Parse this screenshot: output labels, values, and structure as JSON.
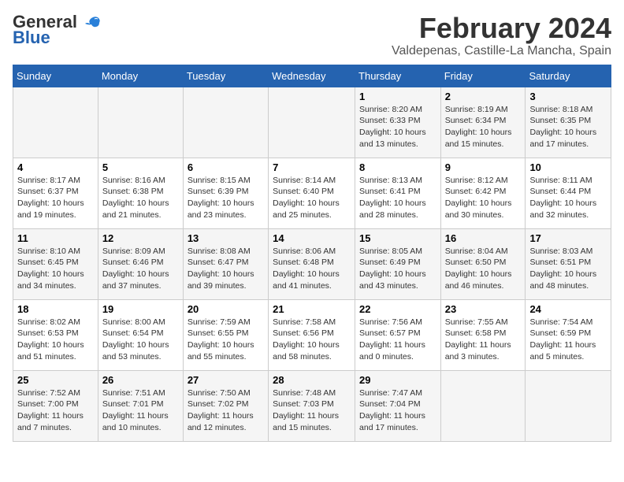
{
  "logo": {
    "general": "General",
    "blue": "Blue"
  },
  "header": {
    "title": "February 2024",
    "subtitle": "Valdepenas, Castille-La Mancha, Spain"
  },
  "weekdays": [
    "Sunday",
    "Monday",
    "Tuesday",
    "Wednesday",
    "Thursday",
    "Friday",
    "Saturday"
  ],
  "weeks": [
    [
      {
        "day": "",
        "detail": ""
      },
      {
        "day": "",
        "detail": ""
      },
      {
        "day": "",
        "detail": ""
      },
      {
        "day": "",
        "detail": ""
      },
      {
        "day": "1",
        "detail": "Sunrise: 8:20 AM\nSunset: 6:33 PM\nDaylight: 10 hours\nand 13 minutes."
      },
      {
        "day": "2",
        "detail": "Sunrise: 8:19 AM\nSunset: 6:34 PM\nDaylight: 10 hours\nand 15 minutes."
      },
      {
        "day": "3",
        "detail": "Sunrise: 8:18 AM\nSunset: 6:35 PM\nDaylight: 10 hours\nand 17 minutes."
      }
    ],
    [
      {
        "day": "4",
        "detail": "Sunrise: 8:17 AM\nSunset: 6:37 PM\nDaylight: 10 hours\nand 19 minutes."
      },
      {
        "day": "5",
        "detail": "Sunrise: 8:16 AM\nSunset: 6:38 PM\nDaylight: 10 hours\nand 21 minutes."
      },
      {
        "day": "6",
        "detail": "Sunrise: 8:15 AM\nSunset: 6:39 PM\nDaylight: 10 hours\nand 23 minutes."
      },
      {
        "day": "7",
        "detail": "Sunrise: 8:14 AM\nSunset: 6:40 PM\nDaylight: 10 hours\nand 25 minutes."
      },
      {
        "day": "8",
        "detail": "Sunrise: 8:13 AM\nSunset: 6:41 PM\nDaylight: 10 hours\nand 28 minutes."
      },
      {
        "day": "9",
        "detail": "Sunrise: 8:12 AM\nSunset: 6:42 PM\nDaylight: 10 hours\nand 30 minutes."
      },
      {
        "day": "10",
        "detail": "Sunrise: 8:11 AM\nSunset: 6:44 PM\nDaylight: 10 hours\nand 32 minutes."
      }
    ],
    [
      {
        "day": "11",
        "detail": "Sunrise: 8:10 AM\nSunset: 6:45 PM\nDaylight: 10 hours\nand 34 minutes."
      },
      {
        "day": "12",
        "detail": "Sunrise: 8:09 AM\nSunset: 6:46 PM\nDaylight: 10 hours\nand 37 minutes."
      },
      {
        "day": "13",
        "detail": "Sunrise: 8:08 AM\nSunset: 6:47 PM\nDaylight: 10 hours\nand 39 minutes."
      },
      {
        "day": "14",
        "detail": "Sunrise: 8:06 AM\nSunset: 6:48 PM\nDaylight: 10 hours\nand 41 minutes."
      },
      {
        "day": "15",
        "detail": "Sunrise: 8:05 AM\nSunset: 6:49 PM\nDaylight: 10 hours\nand 43 minutes."
      },
      {
        "day": "16",
        "detail": "Sunrise: 8:04 AM\nSunset: 6:50 PM\nDaylight: 10 hours\nand 46 minutes."
      },
      {
        "day": "17",
        "detail": "Sunrise: 8:03 AM\nSunset: 6:51 PM\nDaylight: 10 hours\nand 48 minutes."
      }
    ],
    [
      {
        "day": "18",
        "detail": "Sunrise: 8:02 AM\nSunset: 6:53 PM\nDaylight: 10 hours\nand 51 minutes."
      },
      {
        "day": "19",
        "detail": "Sunrise: 8:00 AM\nSunset: 6:54 PM\nDaylight: 10 hours\nand 53 minutes."
      },
      {
        "day": "20",
        "detail": "Sunrise: 7:59 AM\nSunset: 6:55 PM\nDaylight: 10 hours\nand 55 minutes."
      },
      {
        "day": "21",
        "detail": "Sunrise: 7:58 AM\nSunset: 6:56 PM\nDaylight: 10 hours\nand 58 minutes."
      },
      {
        "day": "22",
        "detail": "Sunrise: 7:56 AM\nSunset: 6:57 PM\nDaylight: 11 hours\nand 0 minutes."
      },
      {
        "day": "23",
        "detail": "Sunrise: 7:55 AM\nSunset: 6:58 PM\nDaylight: 11 hours\nand 3 minutes."
      },
      {
        "day": "24",
        "detail": "Sunrise: 7:54 AM\nSunset: 6:59 PM\nDaylight: 11 hours\nand 5 minutes."
      }
    ],
    [
      {
        "day": "25",
        "detail": "Sunrise: 7:52 AM\nSunset: 7:00 PM\nDaylight: 11 hours\nand 7 minutes."
      },
      {
        "day": "26",
        "detail": "Sunrise: 7:51 AM\nSunset: 7:01 PM\nDaylight: 11 hours\nand 10 minutes."
      },
      {
        "day": "27",
        "detail": "Sunrise: 7:50 AM\nSunset: 7:02 PM\nDaylight: 11 hours\nand 12 minutes."
      },
      {
        "day": "28",
        "detail": "Sunrise: 7:48 AM\nSunset: 7:03 PM\nDaylight: 11 hours\nand 15 minutes."
      },
      {
        "day": "29",
        "detail": "Sunrise: 7:47 AM\nSunset: 7:04 PM\nDaylight: 11 hours\nand 17 minutes."
      },
      {
        "day": "",
        "detail": ""
      },
      {
        "day": "",
        "detail": ""
      }
    ]
  ]
}
